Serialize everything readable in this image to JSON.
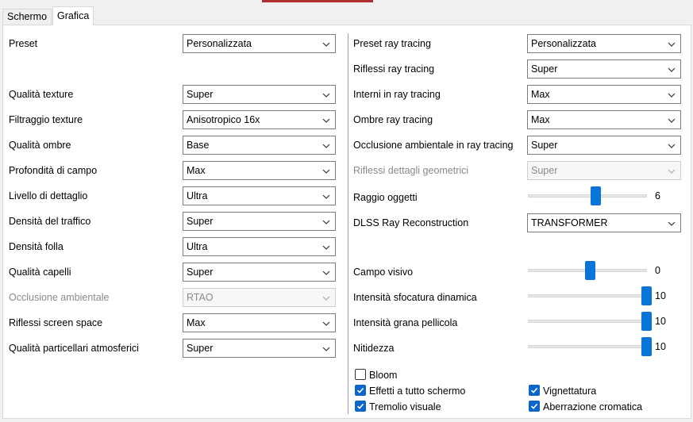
{
  "tabs": [
    "Schermo",
    "Grafica"
  ],
  "left": [
    {
      "label": "Preset",
      "value": "Personalizzata",
      "disabled": false
    },
    {
      "label": "Qualità texture",
      "value": "Super",
      "disabled": false
    },
    {
      "label": "Filtraggio texture",
      "value": "Anisotropico 16x",
      "disabled": false
    },
    {
      "label": "Qualità ombre",
      "value": "Base",
      "disabled": false
    },
    {
      "label": "Profondità di campo",
      "value": "Max",
      "disabled": false
    },
    {
      "label": "Livello di dettaglio",
      "value": "Ultra",
      "disabled": false
    },
    {
      "label": "Densità del traffico",
      "value": "Super",
      "disabled": false
    },
    {
      "label": "Densità folla",
      "value": "Ultra",
      "disabled": false
    },
    {
      "label": "Qualità capelli",
      "value": "Super",
      "disabled": false
    },
    {
      "label": "Occlusione ambientale",
      "value": "RTAO",
      "disabled": true
    },
    {
      "label": "Riflessi screen space",
      "value": "Max",
      "disabled": false
    },
    {
      "label": "Qualità particellari atmosferici",
      "value": "Super",
      "disabled": false
    }
  ],
  "right": [
    {
      "label": "Preset ray tracing",
      "value": "Personalizzata",
      "disabled": false
    },
    {
      "label": "Riflessi ray tracing",
      "value": "Super",
      "disabled": false
    },
    {
      "label": "Interni in ray tracing",
      "value": "Max",
      "disabled": false
    },
    {
      "label": "Ombre ray tracing",
      "value": "Max",
      "disabled": false
    },
    {
      "label": "Occlusione ambientale in ray tracing",
      "value": "Super",
      "disabled": false
    },
    {
      "label": "Riflessi dettagli geometrici",
      "value": "Super",
      "disabled": true
    },
    {
      "label": "DLSS Ray Reconstruction",
      "value": "TRANSFORMER",
      "disabled": false
    }
  ],
  "sliders": [
    {
      "label": "Raggio oggetti",
      "value": "6",
      "fraction": 0.55
    },
    {
      "label": "Campo visivo",
      "value": "0",
      "fraction": 0.5
    },
    {
      "label": "Intensità sfocatura dinamica",
      "value": "10",
      "fraction": 1.0
    },
    {
      "label": "Intensità grana pellicola",
      "value": "10",
      "fraction": 1.0
    },
    {
      "label": "Nitidezza",
      "value": "10",
      "fraction": 1.0
    }
  ],
  "checkboxes": [
    {
      "label": "Bloom",
      "checked": false
    },
    {
      "label": "Effetti a tutto schermo",
      "checked": true
    },
    {
      "label": "Vignettatura",
      "checked": true
    },
    {
      "label": "Tremolio visuale",
      "checked": true
    },
    {
      "label": "Aberrazione cromatica",
      "checked": true
    }
  ]
}
